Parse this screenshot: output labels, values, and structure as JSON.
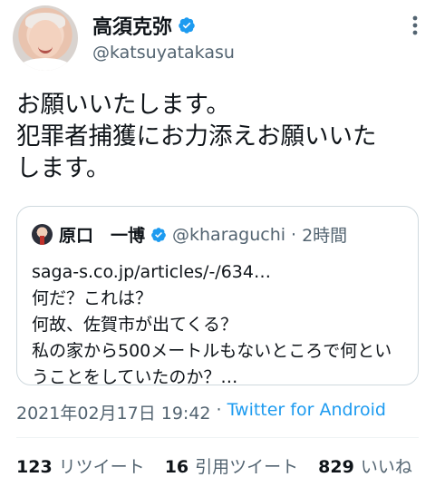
{
  "author": {
    "display_name": "高須克弥",
    "handle": "@katsuyatakasu"
  },
  "tweet_text": "お願いいたします。\n犯罪者捕獲にお力添えお願いいた\nします。",
  "quoted": {
    "name": "原口　一博",
    "handle": "@kharaguchi",
    "separator": "·",
    "time": "2時間",
    "text": "saga-s.co.jp/articles/-/634…\n何だ？これは？\n何故、佐賀市が出てくる？\n私の家から500メートルもないところで何とい\nうことをしていたのか？…"
  },
  "meta": {
    "timestamp": "2021年02月17日 19:42",
    "separator": "·",
    "source": "Twitter for Android"
  },
  "stats": {
    "retweets": "123",
    "retweets_label": "リツイート",
    "quotes": "16",
    "quotes_label": "引用ツイート",
    "likes": "829",
    "likes_label": "いいね"
  },
  "colors": {
    "verified": "#1d9bf0",
    "link": "#1d9bf0",
    "secondary_text": "#536471",
    "border": "#cfd9de"
  },
  "icons": {
    "verified": "verified-badge-icon",
    "more": "more-options-icon"
  }
}
